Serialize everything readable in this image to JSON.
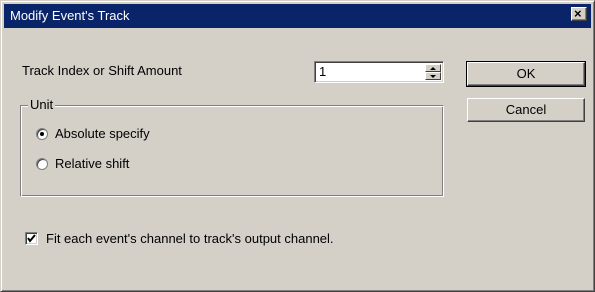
{
  "window": {
    "title": "Modify Event's Track",
    "close_glyph": "×"
  },
  "track": {
    "label": "Track Index or Shift Amount",
    "value": "1"
  },
  "buttons": {
    "ok": "OK",
    "cancel": "Cancel"
  },
  "unit": {
    "legend": "Unit",
    "options": [
      {
        "label": "Absolute specify",
        "selected": true
      },
      {
        "label": "Relative shift",
        "selected": false
      }
    ]
  },
  "fit_channel": {
    "label": "Fit each event's channel to track's output channel.",
    "checked": true
  }
}
